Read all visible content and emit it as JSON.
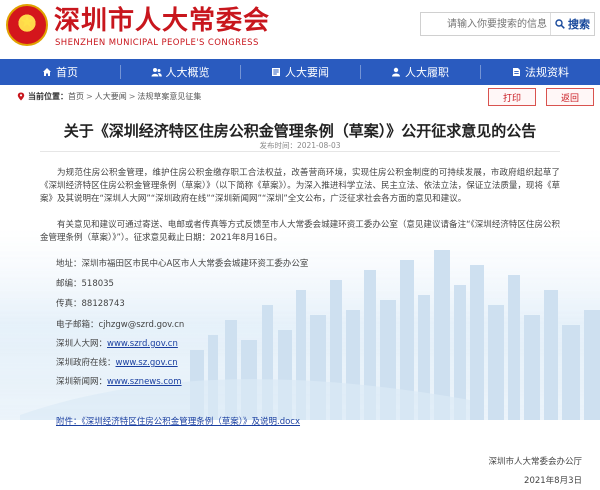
{
  "header": {
    "title": "深圳市人大常委会",
    "subtitle": "SHENZHEN MUNICIPAL PEOPLE'S CONGRESS",
    "brand_color": "#c8161d"
  },
  "search": {
    "placeholder": "请输入你要搜索的信息",
    "button_label": "搜索"
  },
  "nav": {
    "bg_color": "#2a5bbf",
    "items": [
      {
        "label": "首页",
        "icon": "home-icon"
      },
      {
        "label": "人大概览",
        "icon": "people-icon"
      },
      {
        "label": "人大要闻",
        "icon": "news-icon"
      },
      {
        "label": "人大履职",
        "icon": "duty-icon"
      },
      {
        "label": "法规资料",
        "icon": "document-icon"
      }
    ]
  },
  "breadcrumb": {
    "label": "当前位置：",
    "items": [
      "首页",
      "人大要闻",
      "法规草案意见征集"
    ],
    "separator": ">"
  },
  "actions": {
    "print": "打印",
    "back": "返回"
  },
  "article": {
    "title": "关于《深圳经济特区住房公积金管理条例（草案）》公开征求意见的公告",
    "date": "发布时间：2021-08-03",
    "paragraph1": "为规范住房公积金管理，维护住房公积金缴存职工合法权益，改善营商环境，实现住房公积金制度的可持续发展，市政府组织起草了《深圳经济特区住房公积金管理条例（草案）》（以下简称《草案》）。为深入推进科学立法、民主立法、依法立法，保证立法质量，现将《草案》及其说明在“深圳人大网”“深圳政府在线”“深圳新闻网”“深圳”全文公布，广泛征求社会各方面的意见和建议。",
    "paragraph2": "有关意见和建议可通过寄送、电邮或者传真等方式反馈至市人大常委会城建环资工委办公室（意见建议请备注“《深圳经济特区住房公积金管理条例（草案）》”）。征求意见截止日期：2021年8月16日。",
    "address": "地址：深圳市福田区市民中心A区市人大常委会城建环资工委办公室",
    "postcode": "邮编：518035",
    "fax": "传真：88128743",
    "email": "电子邮箱：cjhzgw@szrd.gov.cn",
    "links": [
      {
        "label": "深圳人大网：",
        "url": "www.szrd.gov.cn"
      },
      {
        "label": "深圳政府在线：",
        "url": "www.sz.gov.cn"
      },
      {
        "label": "深圳新闻网：",
        "url": "www.sznews.com"
      }
    ],
    "attachment": "附件：《深圳经济特区住房公积金管理条例（草案）》及说明.docx",
    "signature": "深圳市人大常委会办公厅",
    "sign_date": "2021年8月3日"
  }
}
